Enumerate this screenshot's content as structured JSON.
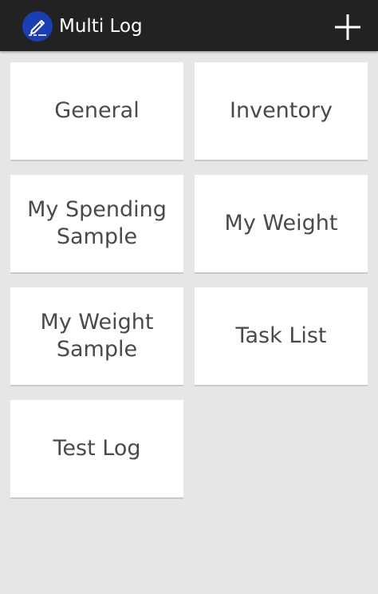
{
  "header": {
    "app_icon": "pen-signature-icon",
    "title": "Multi Log",
    "add_icon": "plus-icon"
  },
  "logs": [
    {
      "label": "General"
    },
    {
      "label": "Inventory"
    },
    {
      "label": "My Spending Sample"
    },
    {
      "label": "My Weight"
    },
    {
      "label": "My Weight Sample"
    },
    {
      "label": "Task List"
    },
    {
      "label": "Test Log"
    }
  ],
  "colors": {
    "topbar": "#222222",
    "app_icon_bg": "#1a3fb4",
    "background": "#e6e6e6",
    "tile": "#ffffff",
    "tile_text": "#4a4a4a"
  }
}
